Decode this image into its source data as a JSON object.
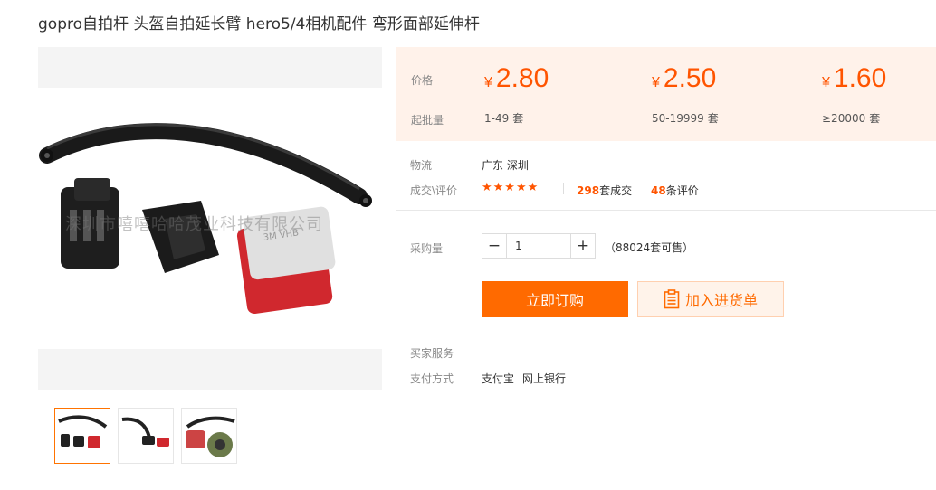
{
  "title": "gopro自拍杆 头盔自拍延长臂 hero5/4相机配件 弯形面部延伸杆",
  "gallery": {
    "watermark": "深圳市嘻嘻哈哈茂业科技有限公司",
    "thumb_count": 3,
    "active_thumb": 1
  },
  "price_box": {
    "price_label": "价格",
    "moq_label": "起批量",
    "tiers": [
      {
        "currency": "¥",
        "price": "2.80",
        "range": "1-49",
        "unit": "套"
      },
      {
        "currency": "¥",
        "price": "2.50",
        "range": "50-19999",
        "unit": "套"
      },
      {
        "currency": "¥",
        "price": "1.60",
        "range": "≥20000",
        "unit": "套"
      }
    ]
  },
  "logistics": {
    "label": "物流",
    "value": "广东 深圳"
  },
  "reviews": {
    "label": "成交\\评价",
    "stars": "★★★★★",
    "deals_count": "298",
    "deals_text": "套成交",
    "review_count": "48",
    "review_text": "条评价"
  },
  "purchase": {
    "label": "采购量",
    "minus": "−",
    "plus": "+",
    "quantity": "1",
    "stock": "（88024套可售）"
  },
  "actions": {
    "buy_label": "立即订购",
    "cart_label": "加入进货单"
  },
  "services": {
    "label": "买家服务"
  },
  "payment": {
    "label": "支付方式",
    "methods": [
      "支付宝",
      "网上银行"
    ]
  },
  "colors": {
    "accent": "#ff6a00",
    "price": "#ff5400",
    "price_bg": "#fff2ea"
  }
}
